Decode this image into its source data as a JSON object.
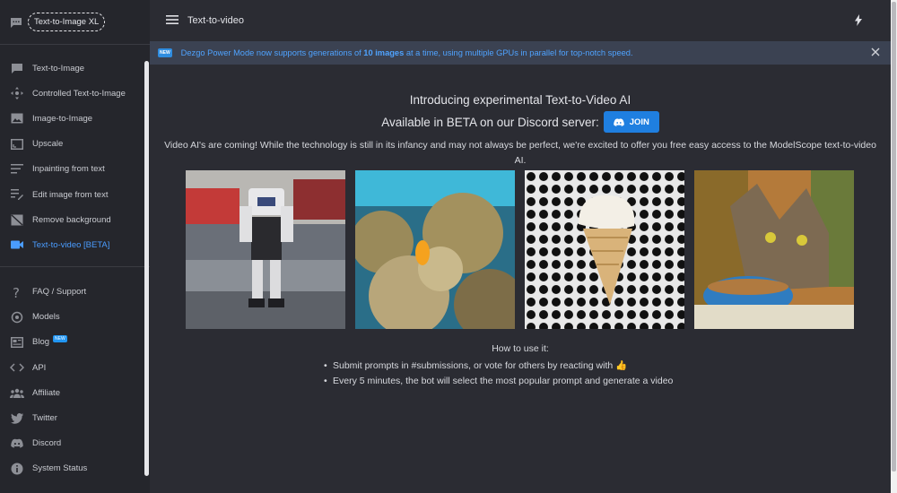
{
  "sidebar": {
    "model_chip": "Text-to-Image XL",
    "group1": [
      {
        "label": "Text-to-Image",
        "icon": "chat-bubble-icon"
      },
      {
        "label": "Controlled Text-to-Image",
        "icon": "move-arrows-icon"
      },
      {
        "label": "Image-to-Image",
        "icon": "image-icon"
      },
      {
        "label": "Upscale",
        "icon": "upscale-icon"
      },
      {
        "label": "Inpainting from text",
        "icon": "text-lines-icon"
      },
      {
        "label": "Edit image from text",
        "icon": "edit-lines-icon"
      },
      {
        "label": "Remove background",
        "icon": "image-off-icon"
      },
      {
        "label": "Text-to-video [BETA]",
        "icon": "video-icon",
        "active": true
      }
    ],
    "group2": [
      {
        "label": "FAQ / Support",
        "icon": "question-icon"
      },
      {
        "label": "Models",
        "icon": "models-icon"
      },
      {
        "label": "Blog",
        "icon": "blog-icon",
        "badge": "NEW"
      },
      {
        "label": "API",
        "icon": "code-icon"
      },
      {
        "label": "Affiliate",
        "icon": "people-icon"
      },
      {
        "label": "Twitter",
        "icon": "twitter-icon"
      },
      {
        "label": "Discord",
        "icon": "discord-icon"
      },
      {
        "label": "System Status",
        "icon": "info-icon"
      }
    ]
  },
  "header": {
    "title": "Text-to-video"
  },
  "banner": {
    "new_label": "NEW",
    "text_before": "Dezgo Power Mode now supports generations of ",
    "text_bold": "10 images",
    "text_after": " at a time, using multiple GPUs in parallel for top-notch speed."
  },
  "main": {
    "intro_title": "Introducing experimental Text-to-Video AI",
    "beta_text": "Available in BETA on our Discord server:",
    "join_label": "JOIN",
    "description": "Video AI's are coming! While the technology is still in its infancy and may not always be perfect, we're excited to offer you free easy access to the ModelScope text-to-video AI.",
    "how_title": "How to use it:",
    "steps": [
      "Submit prompts in #submissions, or vote for others by reacting with 👍",
      "Every 5 minutes, the bot will select the most popular prompt and generate a video"
    ]
  },
  "colors": {
    "accent": "#4a9cff",
    "join_button": "#1f7fe0",
    "banner_bg": "#3b4252"
  }
}
